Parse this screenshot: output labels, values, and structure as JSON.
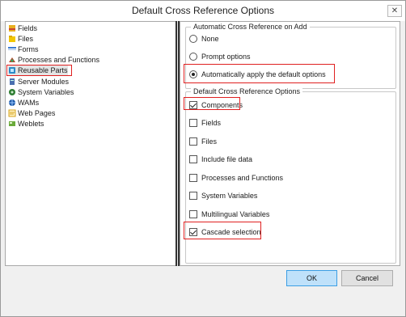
{
  "window": {
    "title": "Default Cross Reference Options",
    "close_glyph": "✕"
  },
  "tree": {
    "items": [
      {
        "label": "Fields",
        "icon": "fields-icon",
        "color": "#d89a1c"
      },
      {
        "label": "Files",
        "icon": "files-icon",
        "color": "#e6b800"
      },
      {
        "label": "Forms",
        "icon": "forms-icon",
        "color": "#3a7bd5"
      },
      {
        "label": "Processes and Functions",
        "icon": "processes-icon",
        "color": "#b04a2a"
      },
      {
        "label": "Reusable Parts",
        "icon": "reusable-parts-icon",
        "color": "#2d8ac7",
        "selected": true
      },
      {
        "label": "Server Modules",
        "icon": "server-modules-icon",
        "color": "#4a6fb0"
      },
      {
        "label": "System Variables",
        "icon": "system-variables-icon",
        "color": "#2e7d32"
      },
      {
        "label": "WAMs",
        "icon": "wams-icon",
        "color": "#1e5aa8"
      },
      {
        "label": "Web Pages",
        "icon": "web-pages-icon",
        "color": "#d4a017"
      },
      {
        "label": "Weblets",
        "icon": "weblets-icon",
        "color": "#6aaa3a"
      }
    ]
  },
  "auto_group": {
    "title": "Automatic Cross Reference on Add",
    "options": [
      {
        "label": "None",
        "checked": false
      },
      {
        "label": "Prompt options",
        "checked": false
      },
      {
        "label": "Automatically apply the default options",
        "checked": true
      }
    ]
  },
  "defaults_group": {
    "title": "Default Cross Reference Options",
    "options": [
      {
        "label": "Components",
        "checked": true
      },
      {
        "label": "Fields",
        "checked": false
      },
      {
        "label": "Files",
        "checked": false
      },
      {
        "label": "Include file data",
        "checked": false
      },
      {
        "label": "Processes and Functions",
        "checked": false
      },
      {
        "label": "System Variables",
        "checked": false
      },
      {
        "label": "Multilingual Variables",
        "checked": false
      },
      {
        "label": "Cascade selection",
        "checked": true
      }
    ]
  },
  "buttons": {
    "ok": "OK",
    "cancel": "Cancel"
  },
  "colors": {
    "highlight": "#e02020",
    "ok_bg": "#bfe1fa"
  }
}
